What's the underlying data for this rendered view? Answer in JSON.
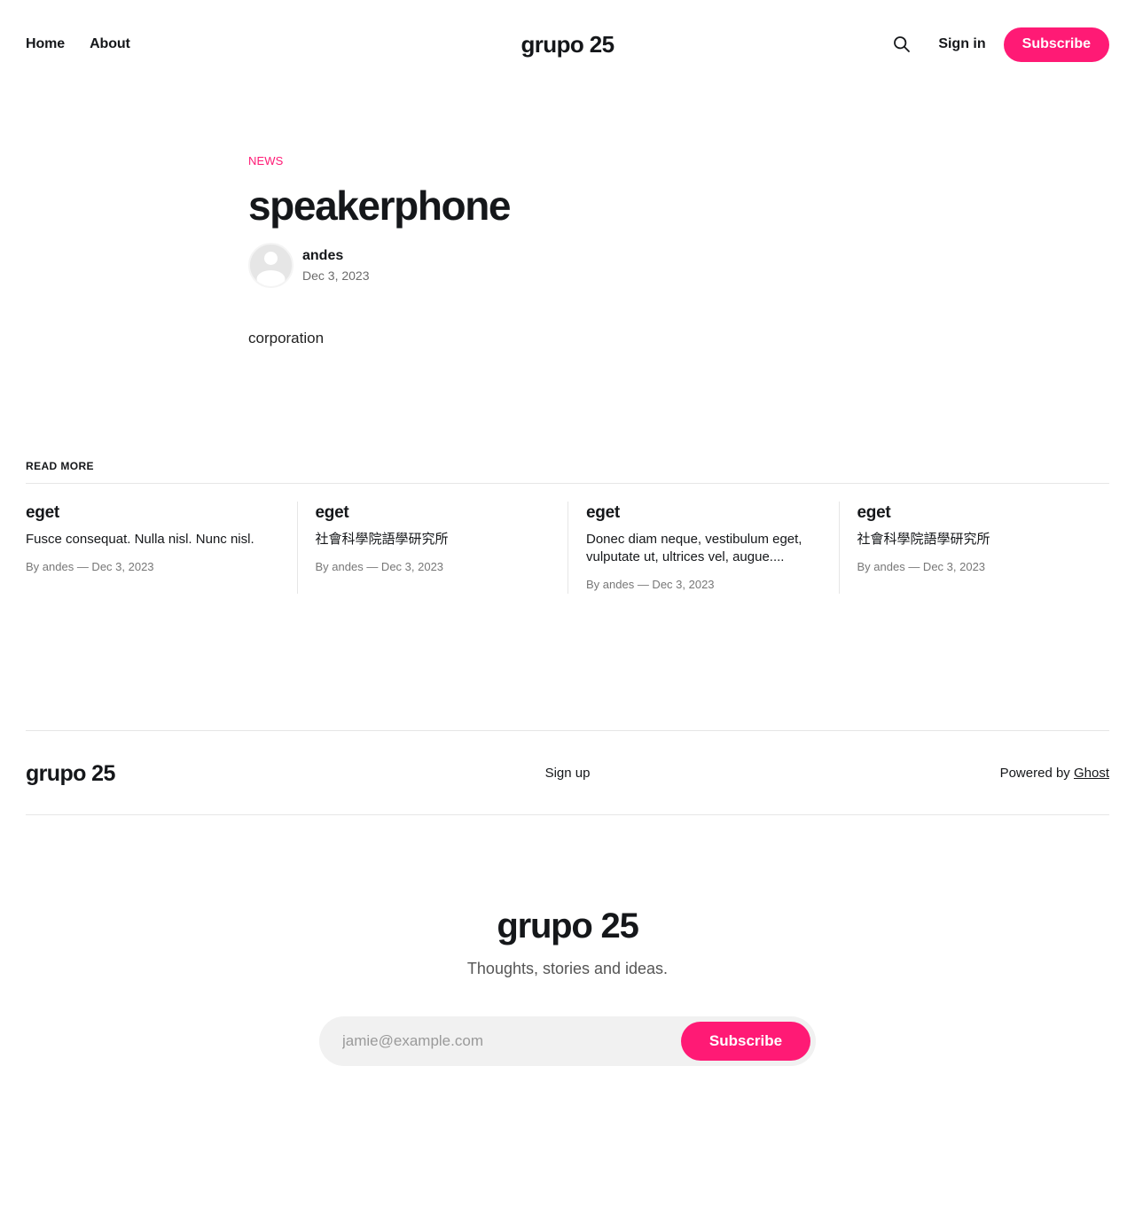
{
  "header": {
    "nav": [
      {
        "label": "Home"
      },
      {
        "label": "About"
      }
    ],
    "site_title": "grupo 25",
    "search_icon": "search-icon",
    "signin_label": "Sign in",
    "subscribe_label": "Subscribe",
    "accent_color": "#ff1a75"
  },
  "post": {
    "tag": "NEWS",
    "title": "speakerphone",
    "author": "andes",
    "date": "Dec 3, 2023",
    "body": "corporation"
  },
  "read_more": {
    "heading": "READ MORE",
    "cards": [
      {
        "title": "eget",
        "excerpt": "Fusce consequat. Nulla nisl. Nunc nisl.",
        "meta": "By andes — Dec 3, 2023"
      },
      {
        "title": "eget",
        "excerpt": "社會科學院語學研究所",
        "meta": "By andes — Dec 3, 2023"
      },
      {
        "title": "eget",
        "excerpt": "Donec diam neque, vestibulum eget, vulputate ut, ultrices vel, augue....",
        "meta": "By andes — Dec 3, 2023"
      },
      {
        "title": "eget",
        "excerpt": "社會科學院語學研究所",
        "meta": "By andes — Dec 3, 2023"
      }
    ]
  },
  "footer": {
    "site_title": "grupo 25",
    "signup_label": "Sign up",
    "powered_prefix": "Powered by ",
    "powered_link": "Ghost"
  },
  "cta": {
    "title": "grupo 25",
    "description": "Thoughts, stories and ideas.",
    "email_placeholder": "jamie@example.com",
    "button_label": "Subscribe"
  }
}
